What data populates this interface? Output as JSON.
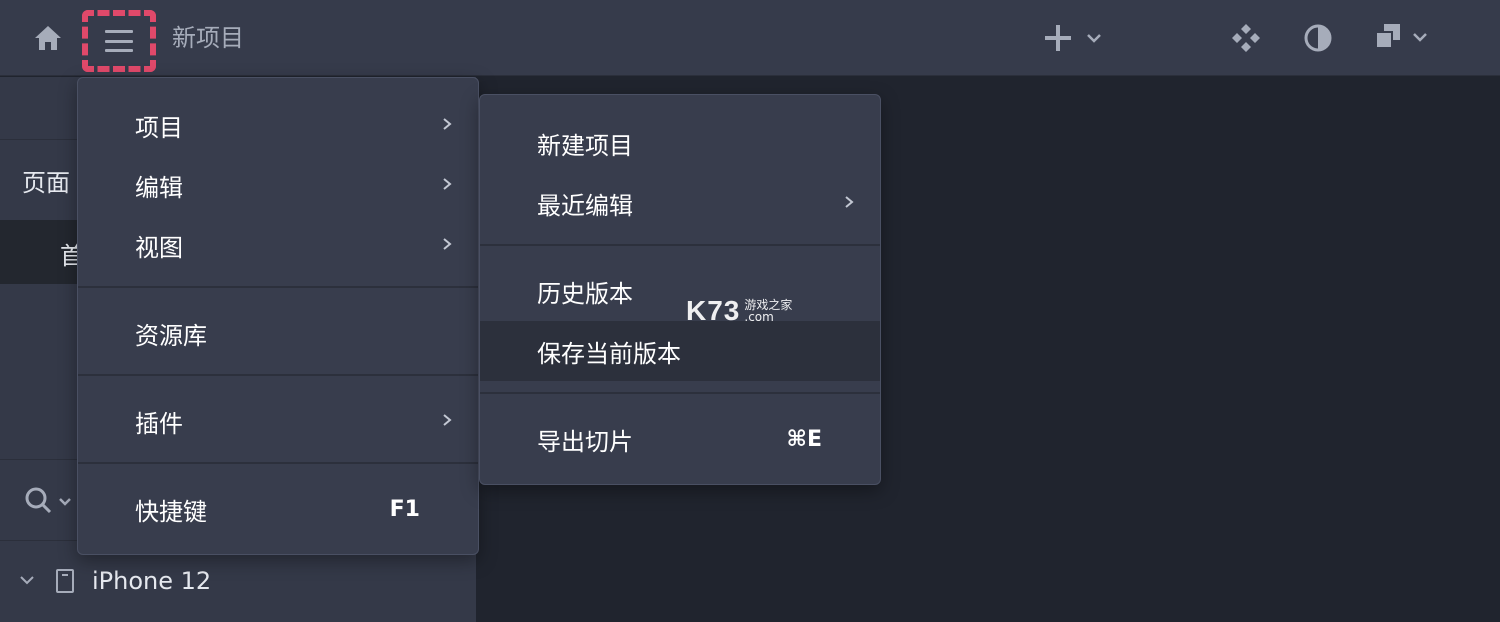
{
  "toolbar": {
    "project_title": "新项目",
    "icons": {
      "home": "home-icon",
      "menu": "hamburger-icon",
      "add": "plus-icon",
      "components": "components-icon",
      "theme": "contrast-icon",
      "arrange": "layers-icon"
    },
    "highlight_color": "#e0496a"
  },
  "left_panel": {
    "pages_label": "页面",
    "page_item": "首",
    "layer_name": "iPhone 12"
  },
  "main_menu": {
    "items": [
      {
        "label": "项目",
        "has_submenu": true
      },
      {
        "label": "编辑",
        "has_submenu": true
      },
      {
        "label": "视图",
        "has_submenu": true
      },
      {
        "label": "资源库",
        "has_submenu": false
      },
      {
        "label": "插件",
        "has_submenu": true
      },
      {
        "label": "快捷键",
        "shortcut": "F1"
      }
    ]
  },
  "sub_menu": {
    "items": [
      {
        "label": "新建项目"
      },
      {
        "label": "最近编辑",
        "has_submenu": true
      },
      {
        "label": "历史版本"
      },
      {
        "label": "保存当前版本",
        "highlighted": true
      },
      {
        "label": "导出切片",
        "shortcut": "⌘E"
      }
    ]
  },
  "watermark": {
    "big": "K73",
    "line1": "游戏之家",
    "line2": ".com"
  }
}
